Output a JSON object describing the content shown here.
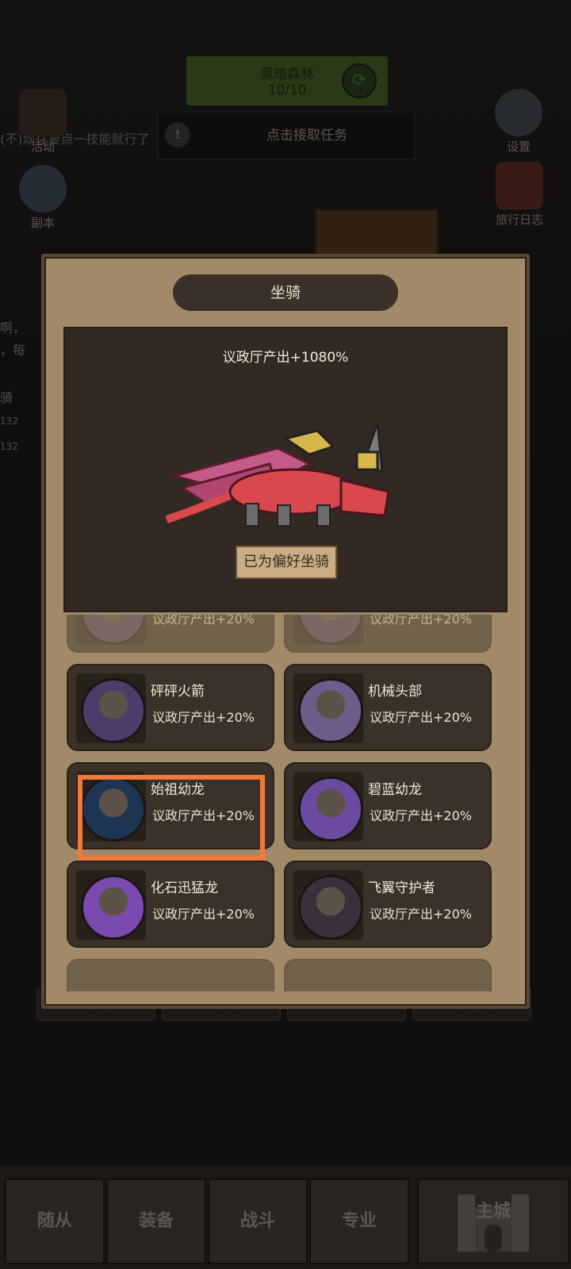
{
  "header": {
    "zone_name": "黑暗森林",
    "zone_progress": "10/10",
    "quest_button": "点击接取任务",
    "ticker_text": "(不)烦往要点一技能就行了",
    "left_icons": [
      {
        "label": "活动"
      },
      {
        "label": "副本"
      }
    ],
    "right_icons": [
      {
        "label": "设置"
      },
      {
        "label": "旅行日志"
      }
    ]
  },
  "background": {
    "chat_lines": [
      "啊，",
      "，每",
      "骑"
    ],
    "level_tags": [
      "132",
      "132"
    ],
    "tabs": [
      "拍卖行",
      "商城",
      "公会",
      "收藏品"
    ]
  },
  "modal": {
    "title": "坐骑",
    "hero_stat": "议政厅产出+1080%",
    "preferred_button": "已为偏好坐骑",
    "mounts": [
      {
        "name": "",
        "bonus": "议政厅产出+20%",
        "avatar_color": "#4c3f5e",
        "faded": true
      },
      {
        "name": "",
        "bonus": "议政厅产出+20%",
        "avatar_color": "#4c3f5e",
        "faded": true
      },
      {
        "name": "砰砰火箭",
        "bonus": "议政厅产出+20%",
        "avatar_color": "#4d3b6a"
      },
      {
        "name": "机械头部",
        "bonus": "议政厅产出+20%",
        "avatar_color": "#6f5b8a"
      },
      {
        "name": "始祖幼龙",
        "bonus": "议政厅产出+20%",
        "avatar_color": "#1d3552"
      },
      {
        "name": "碧蓝幼龙",
        "bonus": "议政厅产出+20%",
        "avatar_color": "#6a4ba0"
      },
      {
        "name": "化石迅猛龙",
        "bonus": "议政厅产出+20%",
        "avatar_color": "#7b4ab0"
      },
      {
        "name": "飞翼守护者",
        "bonus": "议政厅产出+20%",
        "avatar_color": "#3a2f3a"
      }
    ]
  },
  "bottom_nav": [
    "随从",
    "装备",
    "战斗",
    "专业",
    "主城"
  ],
  "colors": {
    "modal_bg": "#a28a68",
    "card_bg": "#3a3129",
    "highlight": "#f07a3c",
    "dragon_red": "#d8484c"
  }
}
